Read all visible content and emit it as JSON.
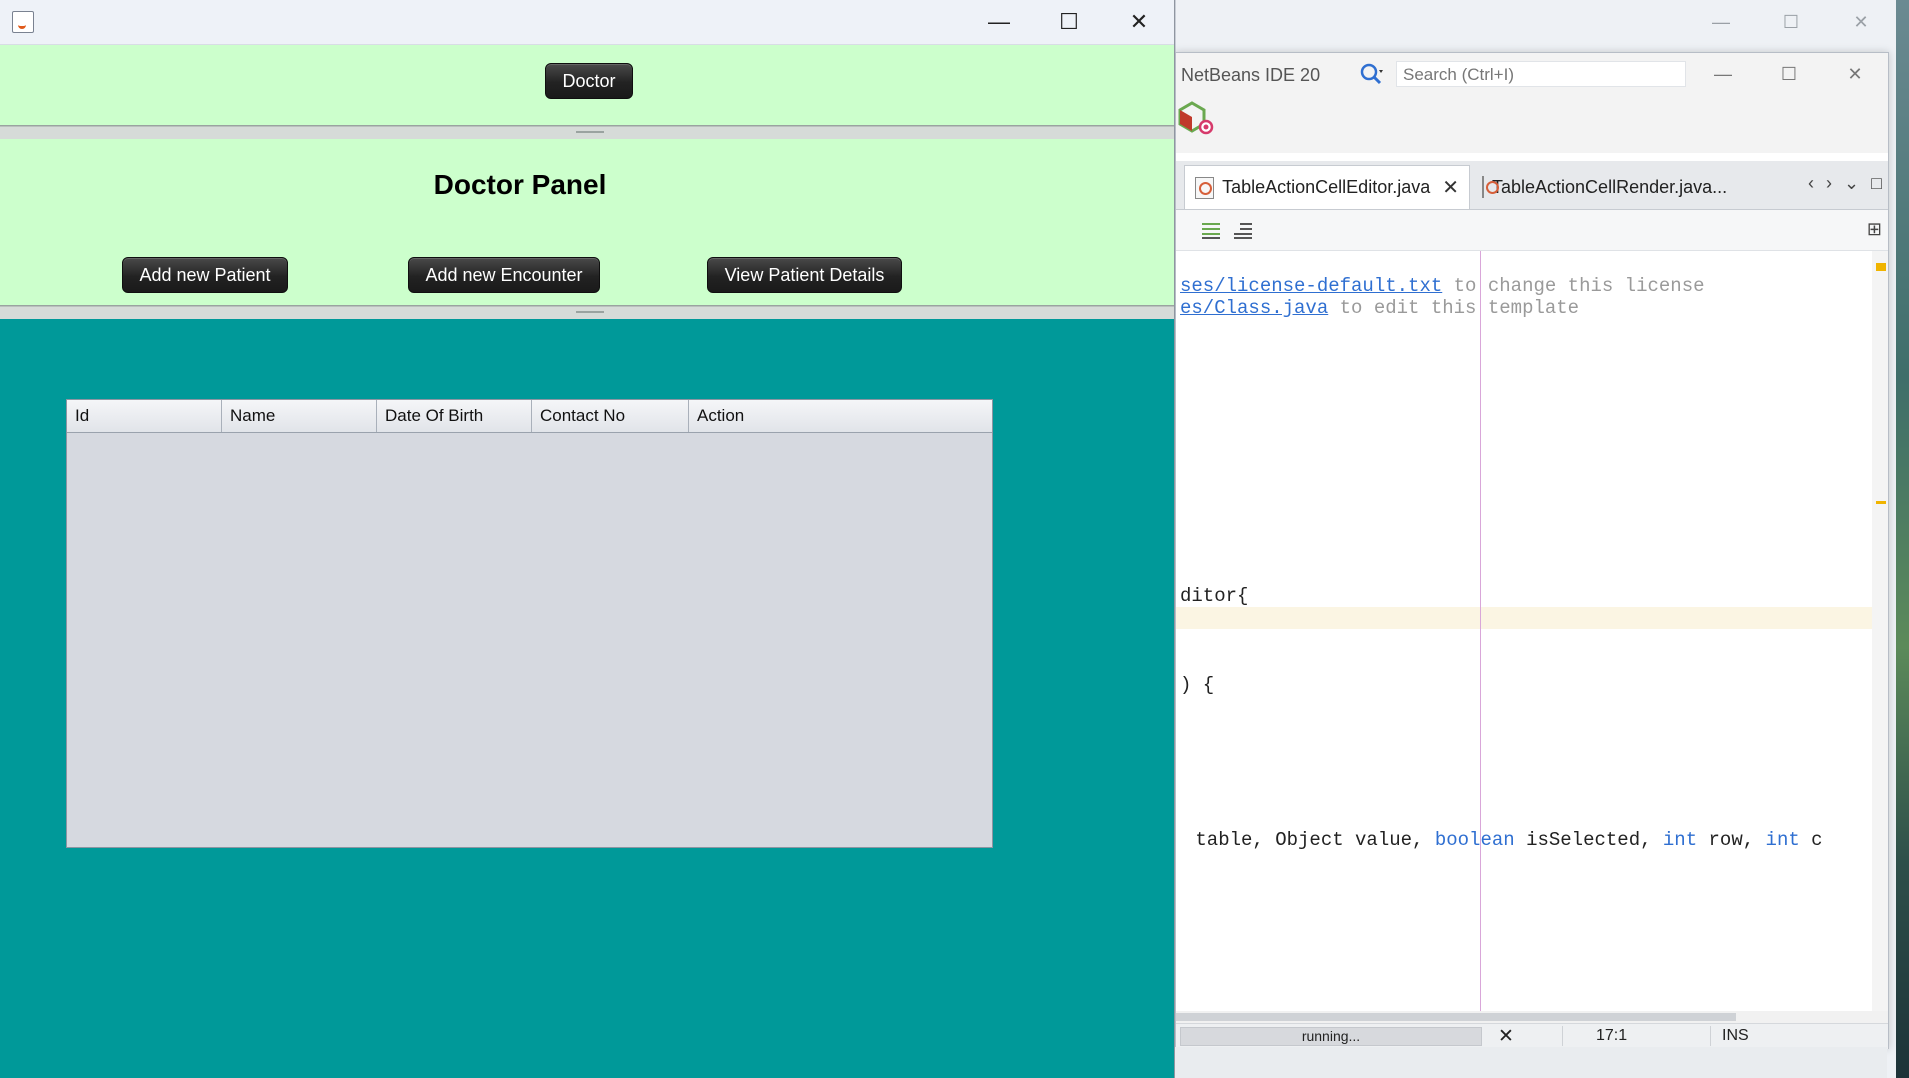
{
  "app": {
    "top_button": "Doctor",
    "panel_title": "Doctor Panel",
    "buttons": {
      "add_patient": "Add new Patient",
      "add_encounter": "Add new Encounter",
      "view_details": "View Patient Details"
    },
    "table": {
      "columns": [
        "Id",
        "Name",
        "Date Of Birth",
        "Contact No",
        "Action"
      ],
      "rows": []
    },
    "colors": {
      "panel_green": "#ccffcc",
      "panel_teal": "#009999",
      "button_dark": "#222222"
    }
  },
  "ide": {
    "title": "NetBeans IDE 20",
    "search_placeholder": "Search (Ctrl+I)",
    "tabs": [
      {
        "label": "TableActionCellEditor.java",
        "active": true
      },
      {
        "label": "TableActionCellRender.java...",
        "active": false
      }
    ],
    "code": {
      "line1_link": "ses/license-default.txt",
      "line1_rest": " to change this license",
      "line2_link": "es/Class.java",
      "line2_rest": " to edit this template",
      "line3": "ditor{",
      "line4": ") {",
      "line5_a": " table, Object value, ",
      "line5_kw1": "boolean",
      "line5_b": " isSelected, ",
      "line5_kw2": "int",
      "line5_c": " row, ",
      "line5_kw3": "int",
      "line5_d": " c"
    },
    "status": {
      "progress": "running...",
      "position": "17:1",
      "mode": "INS"
    }
  }
}
